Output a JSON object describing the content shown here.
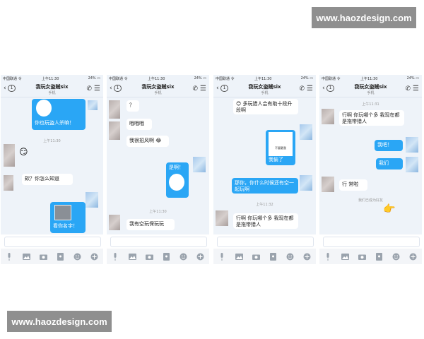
{
  "watermark": {
    "top": "www.haozdesign.com",
    "bottom": "www.haozdesign.com"
  },
  "status": {
    "carrier": "中国联通 令",
    "time": "上午11:30",
    "battery": "24% ▭"
  },
  "chat": {
    "title": "我玩女盗贼six",
    "subtitle": "手机",
    "back_count": "1"
  },
  "icons": {
    "back": "chevron-left-icon",
    "call": "phone-icon",
    "menu": "hamburger-menu-icon",
    "toolbar": [
      "microphone-icon",
      "image-icon",
      "camera-icon",
      "red-packet-icon",
      "emoji-icon",
      "plus-icon"
    ]
  },
  "colors": {
    "out_bubble": "#2aa6f5",
    "in_bubble": "#ffffff",
    "bg": "#eef3f9"
  },
  "phone1": {
    "msg1": "你也玩盗人杀嘛！",
    "ts1": "上午11:30",
    "msg2": "欸？你怎么知道",
    "msg3": "看你名字！"
  },
  "phone2": {
    "msg1": "？",
    "msg2": "哦哦哦",
    "msg3": "我很招风啊 😂",
    "msg4": "是啊！",
    "ts1": "上午11:30",
    "msg5": "我有空玩保玩玩"
  },
  "phone3": {
    "msg1": "😊 多玩猎人会有助十段升段啊",
    "sticker_text": "不要戳我",
    "msg2": "我偷了",
    "msg3": "那你，你什么时候还有空一起玩啊",
    "ts1": "上午11:32",
    "msg4": "行啊 你玩哪个多 我现在都是拖带猎人"
  },
  "phone4": {
    "ts1": "上午11:31",
    "msg1": "行啊 你玩哪个多 我现在都是拖带猎人",
    "msg2": "我吧！",
    "msg3": "我们",
    "msg4": "行 常啦",
    "ts2": "我们已成为好友",
    "emoji": "👉"
  }
}
